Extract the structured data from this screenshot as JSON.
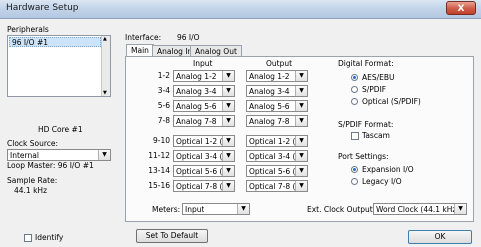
{
  "window": {
    "title": "Hardware Setup",
    "close_glyph": "X"
  },
  "peripherals": {
    "label": "Peripherals",
    "items": [
      "96 I/O #1"
    ],
    "core_label": "HD Core #1"
  },
  "clock": {
    "label": "Clock Source:",
    "value": "Internal",
    "loop_master": "Loop Master: 96 I/O #1"
  },
  "sample_rate": {
    "label": "Sample Rate:",
    "value": "44.1 kHz"
  },
  "interface": {
    "label": "Interface:",
    "value": "96 I/O"
  },
  "tabs": [
    {
      "label": "Main",
      "active": true
    },
    {
      "label": "Analog In",
      "active": false
    },
    {
      "label": "Analog Out",
      "active": false
    }
  ],
  "columns": {
    "input": "Input",
    "output": "Output"
  },
  "channels": [
    {
      "ch": "1-2",
      "input": "Analog 1-2",
      "output": "Analog 1-2"
    },
    {
      "ch": "3-4",
      "input": "Analog 3-4",
      "output": "Analog 3-4"
    },
    {
      "ch": "5-6",
      "input": "Analog 5-6",
      "output": "Analog 5-6"
    },
    {
      "ch": "7-8",
      "input": "Analog 7-8",
      "output": "Analog 7-8"
    },
    {
      "ch": "9-10",
      "input": "Optical 1-2 (ADA",
      "output": "Optical 1-2 (ADA"
    },
    {
      "ch": "11-12",
      "input": "Optical 3-4 (ADA",
      "output": "Optical 3-4 (ADA"
    },
    {
      "ch": "13-14",
      "input": "Optical 5-6 (ADA",
      "output": "Optical 5-6 (ADA"
    },
    {
      "ch": "15-16",
      "input": "Optical 7-8 (ADA",
      "output": "Optical 7-8 (ADA"
    }
  ],
  "digital_format": {
    "label": "Digital Format:",
    "options": [
      "AES/EBU",
      "S/PDIF",
      "Optical (S/PDIF)"
    ],
    "selected": 0
  },
  "spdif_format": {
    "label": "S/PDIF Format:",
    "tascam": "Tascam"
  },
  "port_settings": {
    "label": "Port Settings:",
    "options": [
      "Expansion I/O",
      "Legacy I/O"
    ],
    "selected": 0
  },
  "meters": {
    "label": "Meters:",
    "value": "Input"
  },
  "ext_clock": {
    "label": "Ext. Clock Output:",
    "value": "Word Clock (44.1 kHz)"
  },
  "footer": {
    "identify": "Identify",
    "set_default": "Set To Default",
    "ok": "OK"
  },
  "icons": {
    "dropdown": "▼"
  }
}
